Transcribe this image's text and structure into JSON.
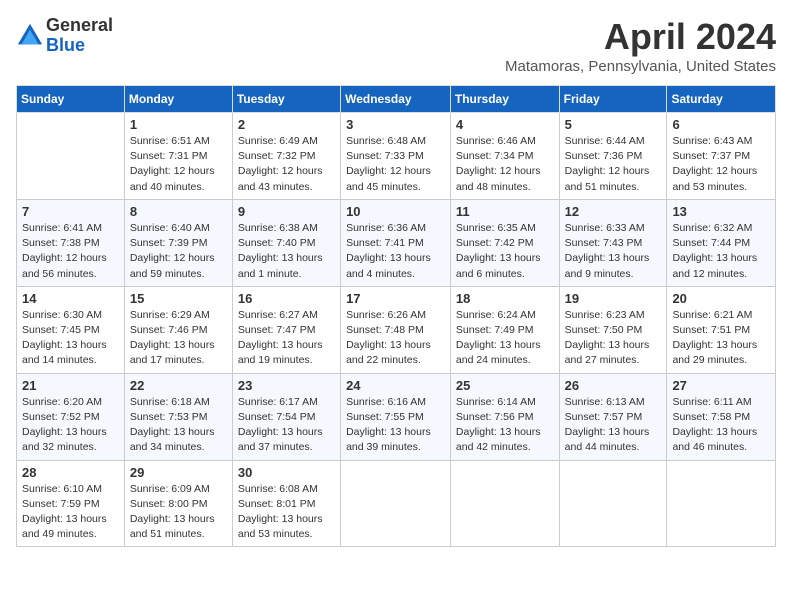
{
  "header": {
    "logo_general": "General",
    "logo_blue": "Blue",
    "month_title": "April 2024",
    "location": "Matamoras, Pennsylvania, United States"
  },
  "weekdays": [
    "Sunday",
    "Monday",
    "Tuesday",
    "Wednesday",
    "Thursday",
    "Friday",
    "Saturday"
  ],
  "weeks": [
    [
      {
        "day": "",
        "info": ""
      },
      {
        "day": "1",
        "info": "Sunrise: 6:51 AM\nSunset: 7:31 PM\nDaylight: 12 hours\nand 40 minutes."
      },
      {
        "day": "2",
        "info": "Sunrise: 6:49 AM\nSunset: 7:32 PM\nDaylight: 12 hours\nand 43 minutes."
      },
      {
        "day": "3",
        "info": "Sunrise: 6:48 AM\nSunset: 7:33 PM\nDaylight: 12 hours\nand 45 minutes."
      },
      {
        "day": "4",
        "info": "Sunrise: 6:46 AM\nSunset: 7:34 PM\nDaylight: 12 hours\nand 48 minutes."
      },
      {
        "day": "5",
        "info": "Sunrise: 6:44 AM\nSunset: 7:36 PM\nDaylight: 12 hours\nand 51 minutes."
      },
      {
        "day": "6",
        "info": "Sunrise: 6:43 AM\nSunset: 7:37 PM\nDaylight: 12 hours\nand 53 minutes."
      }
    ],
    [
      {
        "day": "7",
        "info": "Sunrise: 6:41 AM\nSunset: 7:38 PM\nDaylight: 12 hours\nand 56 minutes."
      },
      {
        "day": "8",
        "info": "Sunrise: 6:40 AM\nSunset: 7:39 PM\nDaylight: 12 hours\nand 59 minutes."
      },
      {
        "day": "9",
        "info": "Sunrise: 6:38 AM\nSunset: 7:40 PM\nDaylight: 13 hours\nand 1 minute."
      },
      {
        "day": "10",
        "info": "Sunrise: 6:36 AM\nSunset: 7:41 PM\nDaylight: 13 hours\nand 4 minutes."
      },
      {
        "day": "11",
        "info": "Sunrise: 6:35 AM\nSunset: 7:42 PM\nDaylight: 13 hours\nand 6 minutes."
      },
      {
        "day": "12",
        "info": "Sunrise: 6:33 AM\nSunset: 7:43 PM\nDaylight: 13 hours\nand 9 minutes."
      },
      {
        "day": "13",
        "info": "Sunrise: 6:32 AM\nSunset: 7:44 PM\nDaylight: 13 hours\nand 12 minutes."
      }
    ],
    [
      {
        "day": "14",
        "info": "Sunrise: 6:30 AM\nSunset: 7:45 PM\nDaylight: 13 hours\nand 14 minutes."
      },
      {
        "day": "15",
        "info": "Sunrise: 6:29 AM\nSunset: 7:46 PM\nDaylight: 13 hours\nand 17 minutes."
      },
      {
        "day": "16",
        "info": "Sunrise: 6:27 AM\nSunset: 7:47 PM\nDaylight: 13 hours\nand 19 minutes."
      },
      {
        "day": "17",
        "info": "Sunrise: 6:26 AM\nSunset: 7:48 PM\nDaylight: 13 hours\nand 22 minutes."
      },
      {
        "day": "18",
        "info": "Sunrise: 6:24 AM\nSunset: 7:49 PM\nDaylight: 13 hours\nand 24 minutes."
      },
      {
        "day": "19",
        "info": "Sunrise: 6:23 AM\nSunset: 7:50 PM\nDaylight: 13 hours\nand 27 minutes."
      },
      {
        "day": "20",
        "info": "Sunrise: 6:21 AM\nSunset: 7:51 PM\nDaylight: 13 hours\nand 29 minutes."
      }
    ],
    [
      {
        "day": "21",
        "info": "Sunrise: 6:20 AM\nSunset: 7:52 PM\nDaylight: 13 hours\nand 32 minutes."
      },
      {
        "day": "22",
        "info": "Sunrise: 6:18 AM\nSunset: 7:53 PM\nDaylight: 13 hours\nand 34 minutes."
      },
      {
        "day": "23",
        "info": "Sunrise: 6:17 AM\nSunset: 7:54 PM\nDaylight: 13 hours\nand 37 minutes."
      },
      {
        "day": "24",
        "info": "Sunrise: 6:16 AM\nSunset: 7:55 PM\nDaylight: 13 hours\nand 39 minutes."
      },
      {
        "day": "25",
        "info": "Sunrise: 6:14 AM\nSunset: 7:56 PM\nDaylight: 13 hours\nand 42 minutes."
      },
      {
        "day": "26",
        "info": "Sunrise: 6:13 AM\nSunset: 7:57 PM\nDaylight: 13 hours\nand 44 minutes."
      },
      {
        "day": "27",
        "info": "Sunrise: 6:11 AM\nSunset: 7:58 PM\nDaylight: 13 hours\nand 46 minutes."
      }
    ],
    [
      {
        "day": "28",
        "info": "Sunrise: 6:10 AM\nSunset: 7:59 PM\nDaylight: 13 hours\nand 49 minutes."
      },
      {
        "day": "29",
        "info": "Sunrise: 6:09 AM\nSunset: 8:00 PM\nDaylight: 13 hours\nand 51 minutes."
      },
      {
        "day": "30",
        "info": "Sunrise: 6:08 AM\nSunset: 8:01 PM\nDaylight: 13 hours\nand 53 minutes."
      },
      {
        "day": "",
        "info": ""
      },
      {
        "day": "",
        "info": ""
      },
      {
        "day": "",
        "info": ""
      },
      {
        "day": "",
        "info": ""
      }
    ]
  ]
}
